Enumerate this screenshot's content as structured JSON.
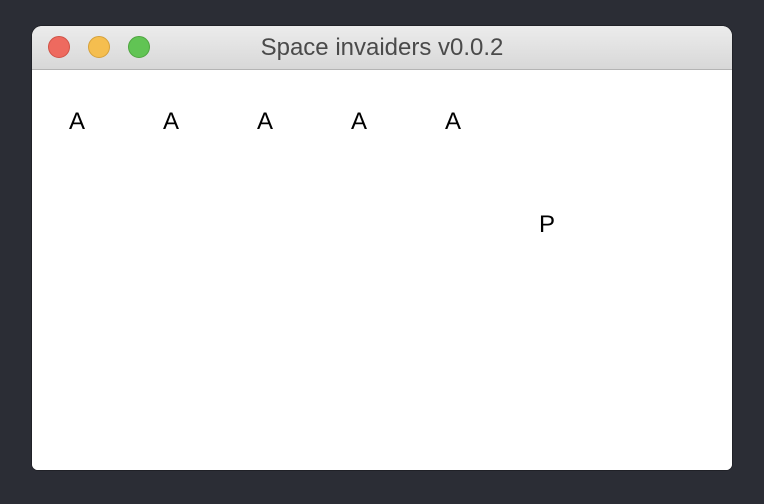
{
  "window": {
    "title": "Space invaiders v0.0.2"
  },
  "game": {
    "aliens": [
      "A",
      "A",
      "A",
      "A",
      "A"
    ],
    "player": "P"
  }
}
